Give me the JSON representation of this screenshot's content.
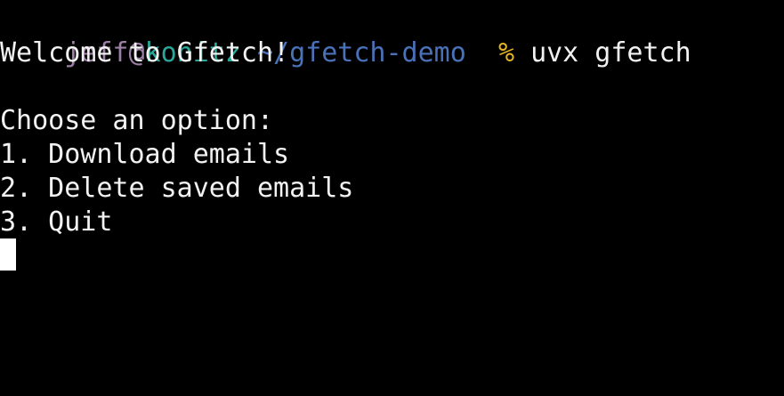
{
  "colors": {
    "background": "#000000",
    "foreground": "#f2f2f2",
    "user": "#9b7fa6",
    "host": "#2aa79b",
    "path": "#4a72b8",
    "prompt_symbol": "#e6b422",
    "cursor": "#ffffff"
  },
  "prompt": {
    "user": "jeff",
    "at": "@",
    "host": "konitz",
    "path": "~/gfetch-demo",
    "symbol": "%",
    "command": "uvx gfetch"
  },
  "output": {
    "welcome": "Welcome to Gfetch!",
    "menu_title": "Choose an option:",
    "options": [
      "1. Download emails",
      "2. Delete saved emails",
      "3. Quit"
    ]
  }
}
